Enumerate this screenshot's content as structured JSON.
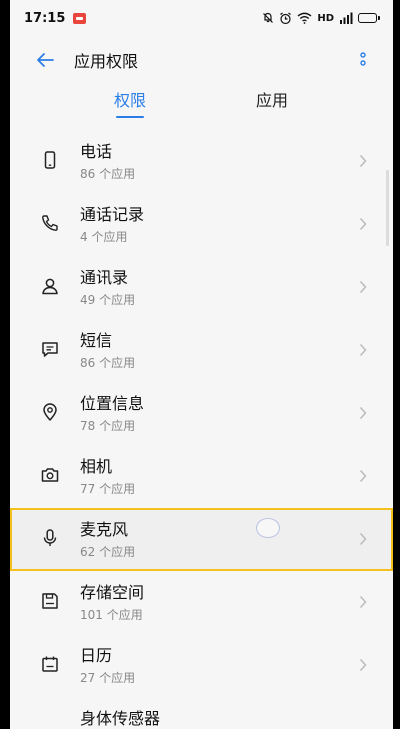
{
  "status": {
    "time": "17:15",
    "network": "HD"
  },
  "header": {
    "title": "应用权限"
  },
  "tabs": [
    {
      "label": "权限",
      "active": true
    },
    {
      "label": "应用",
      "active": false
    }
  ],
  "colors": {
    "accent": "#2a7ee6",
    "highlight": "#f5c01e"
  },
  "permissions": [
    {
      "name": "电话",
      "count": "86 个应用",
      "icon": "phone-device-icon"
    },
    {
      "name": "通话记录",
      "count": "4 个应用",
      "icon": "call-handset-icon"
    },
    {
      "name": "通讯录",
      "count": "49 个应用",
      "icon": "contact-person-icon"
    },
    {
      "name": "短信",
      "count": "86 个应用",
      "icon": "message-icon"
    },
    {
      "name": "位置信息",
      "count": "78 个应用",
      "icon": "location-pin-icon"
    },
    {
      "name": "相机",
      "count": "77 个应用",
      "icon": "camera-icon"
    },
    {
      "name": "麦克风",
      "count": "62 个应用",
      "icon": "microphone-icon"
    },
    {
      "name": "存储空间",
      "count": "101 个应用",
      "icon": "storage-icon"
    },
    {
      "name": "日历",
      "count": "27 个应用",
      "icon": "calendar-icon"
    },
    {
      "name": "身体传感器",
      "count": "",
      "icon": "body-sensor-icon"
    }
  ]
}
